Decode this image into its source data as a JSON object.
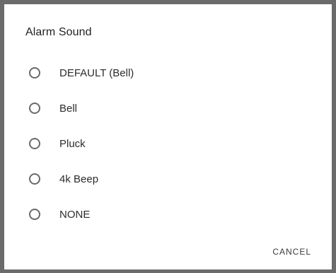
{
  "dialog": {
    "title": "Alarm Sound",
    "options": [
      {
        "label": "DEFAULT (Bell)",
        "selected": false
      },
      {
        "label": "Bell",
        "selected": false
      },
      {
        "label": "Pluck",
        "selected": false
      },
      {
        "label": "4k Beep",
        "selected": false
      },
      {
        "label": "NONE",
        "selected": false
      }
    ],
    "cancel_label": "CANCEL"
  }
}
